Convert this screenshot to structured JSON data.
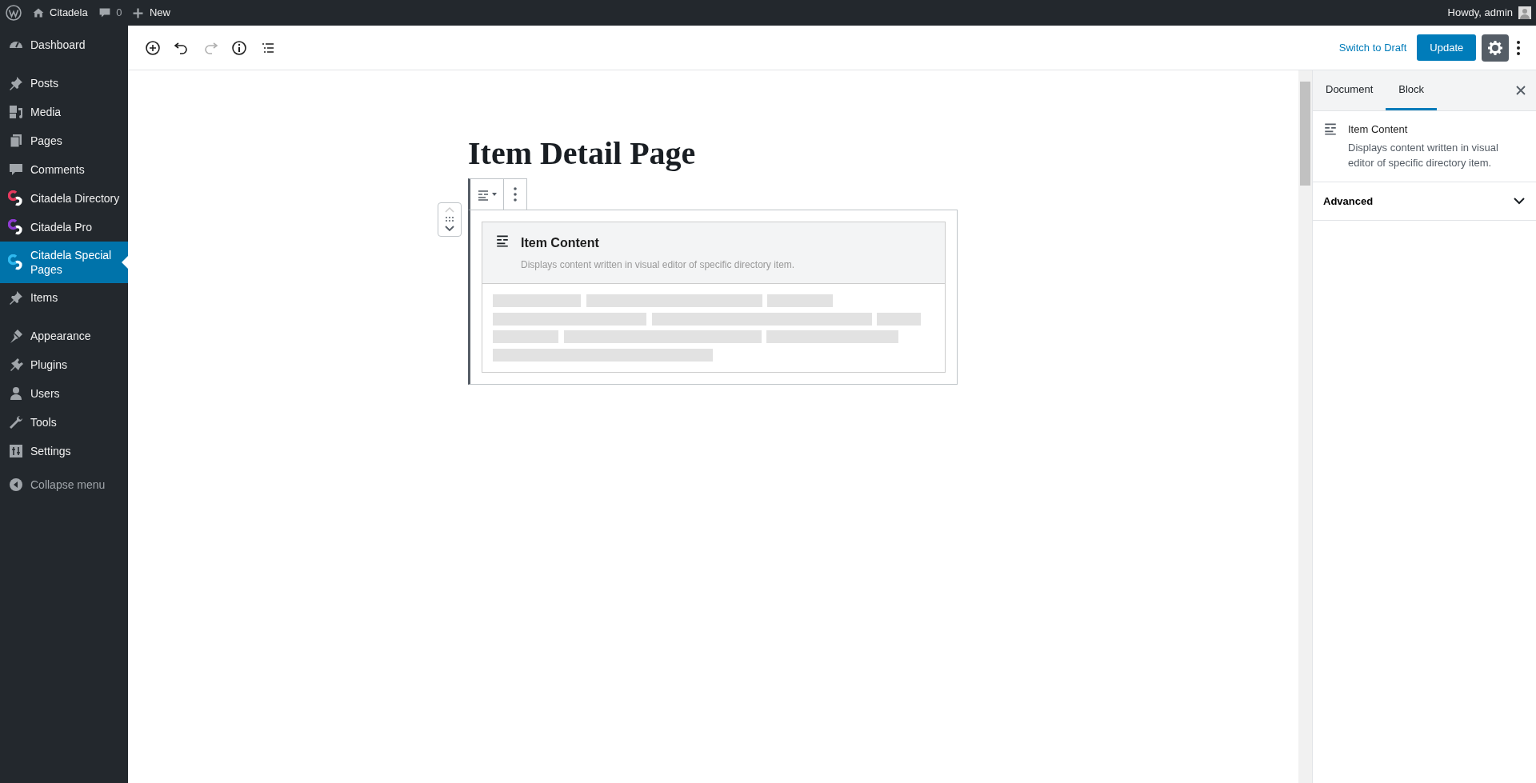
{
  "admin_bar": {
    "site": "Citadela",
    "comments": "0",
    "new": "New",
    "greeting": "Howdy, admin"
  },
  "menu_groups": [
    [
      {
        "label": "Dashboard",
        "selected": false
      }
    ],
    [
      {
        "label": "Posts",
        "selected": false
      },
      {
        "label": "Media",
        "selected": false
      },
      {
        "label": "Pages",
        "selected": false
      },
      {
        "label": "Comments",
        "selected": false
      },
      {
        "label": "Citadela Directory",
        "selected": false
      },
      {
        "label": "Citadela Pro",
        "selected": false
      },
      {
        "label": "Citadela Special Pages",
        "selected": true
      },
      {
        "label": "Items",
        "selected": false
      }
    ],
    [
      {
        "label": "Appearance",
        "selected": false
      },
      {
        "label": "Plugins",
        "selected": false
      },
      {
        "label": "Users",
        "selected": false
      },
      {
        "label": "Tools",
        "selected": false
      },
      {
        "label": "Settings",
        "selected": false
      }
    ]
  ],
  "collapse": "Collapse menu",
  "toolbar": {
    "redo_disabled": true,
    "switch": "Switch to Draft",
    "update": "Update",
    "settings_on": true
  },
  "post_title": "Item Detail Page",
  "block": {
    "title": "Item Content",
    "description": "Displays content written in visual editor of specific directory item."
  },
  "sidebar_tabs": [
    {
      "label": "Document",
      "selected": false
    },
    {
      "label": "Block",
      "selected": true
    }
  ],
  "block_card": {
    "title": "Item Content",
    "description": "Displays content written in visual editor of specific directory item."
  },
  "panels": [
    {
      "label": "Advanced",
      "expanded": false
    }
  ]
}
